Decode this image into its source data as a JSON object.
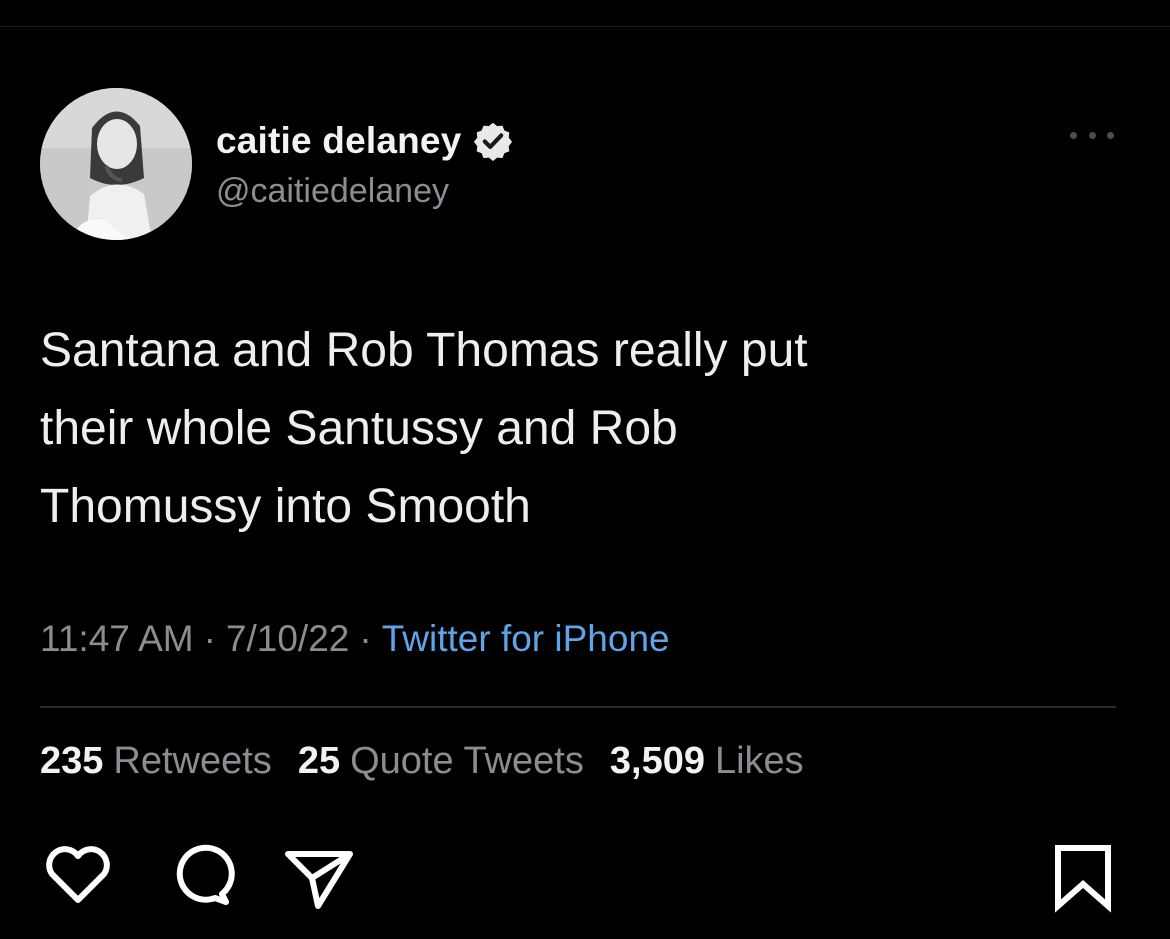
{
  "tweet": {
    "display_name": "caitie delaney",
    "handle": "@caitiedelaney",
    "text_lines": [
      "Santana and Rob Thomas really put",
      "their whole Santussy and Rob",
      "Thomussy into Smooth"
    ],
    "time": "11:47 AM",
    "separator": "·",
    "date": "7/10/22",
    "source": "Twitter for iPhone",
    "stats": {
      "retweets_count": "235",
      "retweets_label": "Retweets",
      "quotes_count": "25",
      "quotes_label": "Quote Tweets",
      "likes_count": "3,509",
      "likes_label": "Likes"
    },
    "icons": {
      "verified": "verified-badge-icon",
      "more": "more-options-icon"
    }
  },
  "post_actions": {
    "icons": [
      "heart-icon",
      "comment-icon",
      "share-icon",
      "bookmark-icon"
    ]
  },
  "colors": {
    "background": "#000000",
    "primary_text": "#eeeeee",
    "secondary_text": "#8a8d91",
    "link": "#5ea4e8"
  }
}
